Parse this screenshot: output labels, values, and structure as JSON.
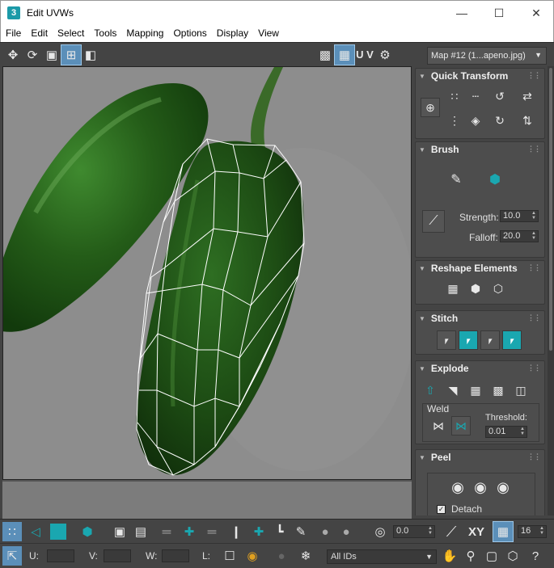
{
  "window": {
    "title": "Edit UVWs",
    "app_icon": "3"
  },
  "menu": [
    "File",
    "Edit",
    "Select",
    "Tools",
    "Mapping",
    "Options",
    "Display",
    "View"
  ],
  "toolbar": {
    "uv_label": "U V",
    "map_select": "Map #12 (1...apeno.jpg)"
  },
  "rollouts": {
    "quick_transform": "Quick Transform",
    "brush": "Brush",
    "strength_label": "Strength:",
    "strength_value": "10.0",
    "falloff_label": "Falloff:",
    "falloff_value": "20.0",
    "reshape": "Reshape Elements",
    "stitch": "Stitch",
    "explode": "Explode",
    "weld_label": "Weld",
    "threshold_label": "Threshold:",
    "threshold_value": "0.01",
    "peel": "Peel",
    "detach_label": "Detach",
    "detach_checked": true
  },
  "bottom": {
    "angle_value": "0.0",
    "xy_label": "XY",
    "count_value": "16",
    "u_label": "U:",
    "v_label": "V:",
    "w_label": "W:",
    "l_label": "L:",
    "ids_select": "All IDs"
  },
  "colors": {
    "accent_teal": "#1aa7b0",
    "panel_bg": "#444444",
    "viewport_bg": "#8c8c8c"
  }
}
